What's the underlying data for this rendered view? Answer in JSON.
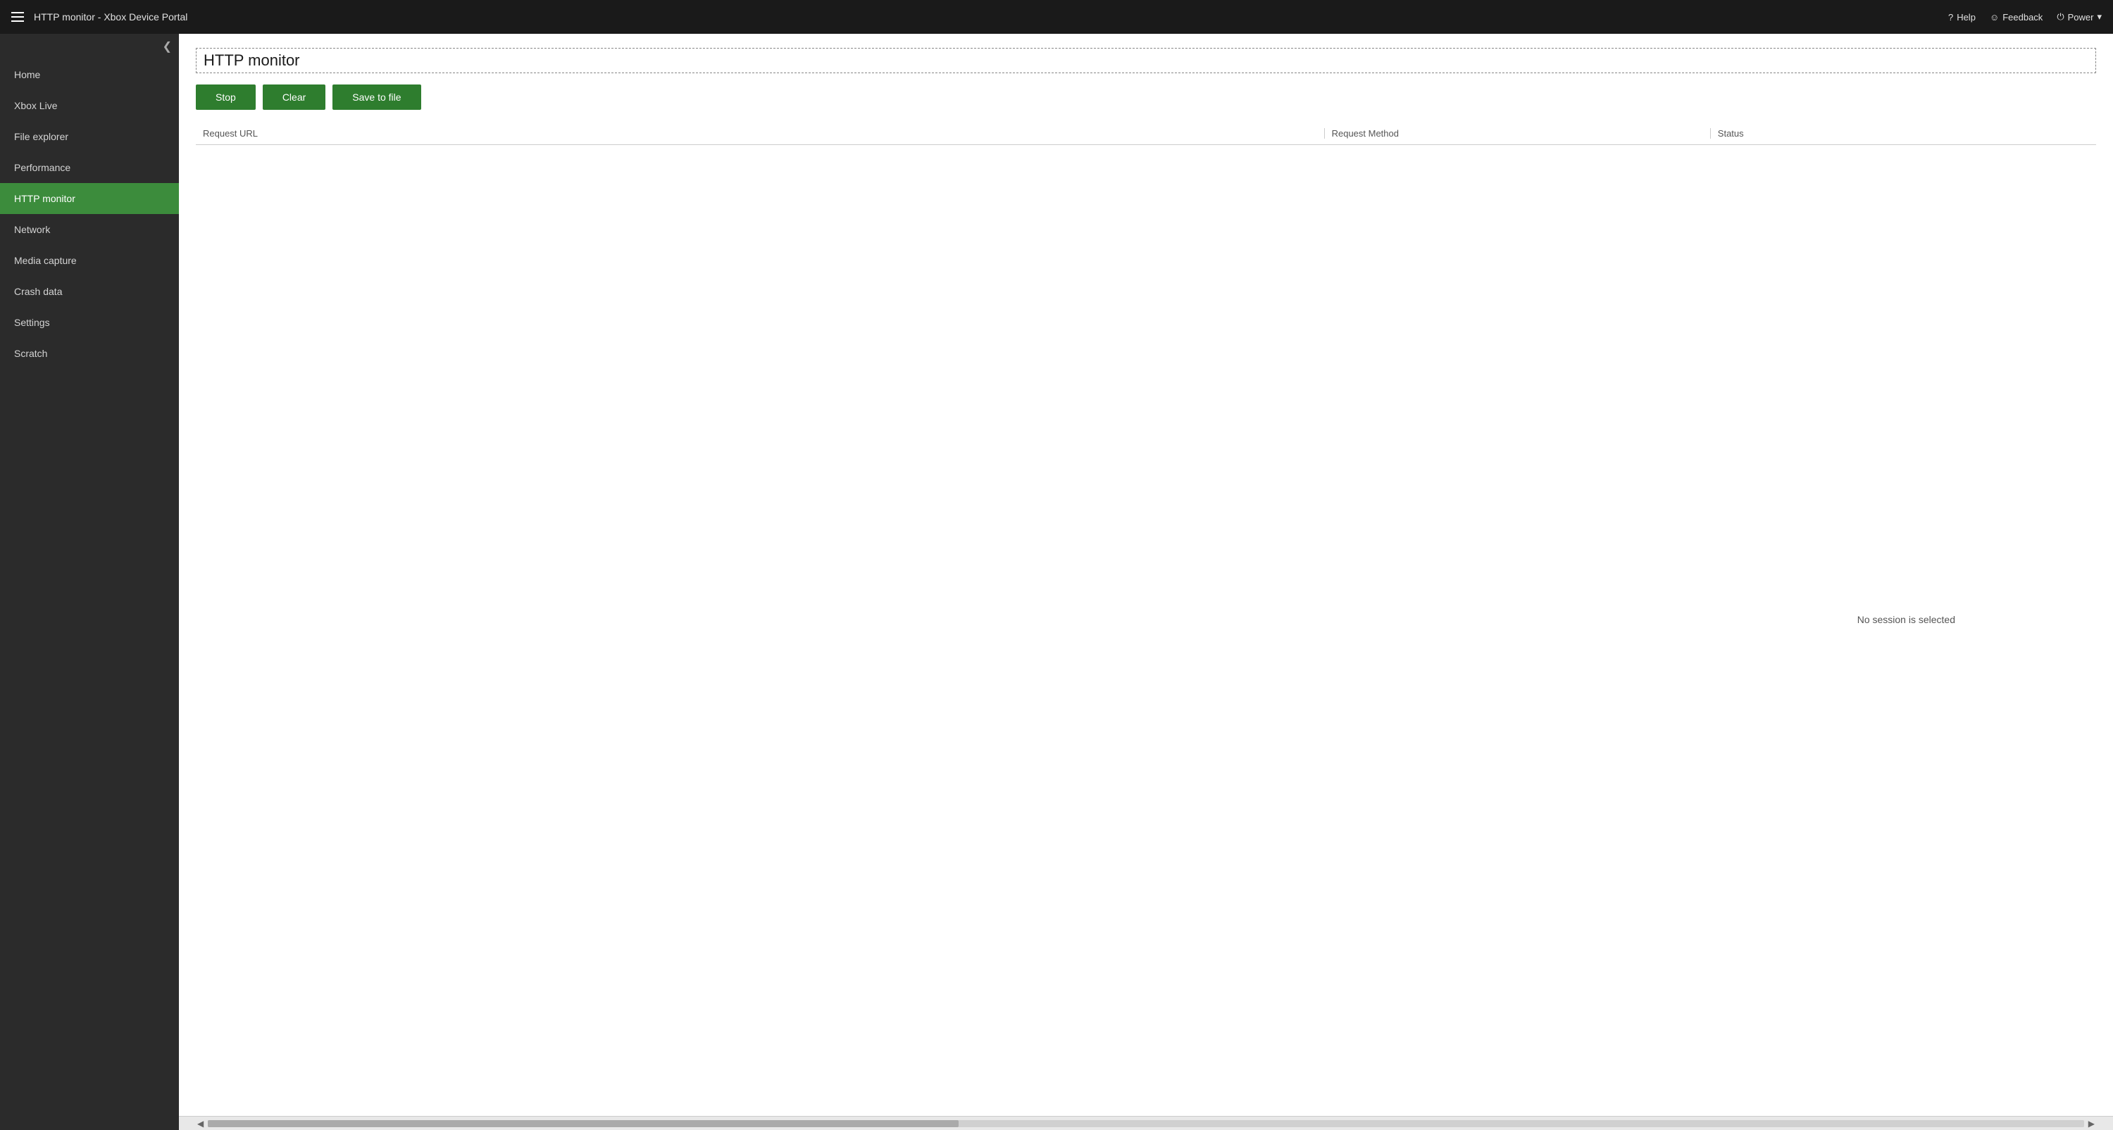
{
  "titlebar": {
    "title": "HTTP monitor - Xbox Device Portal",
    "help_label": "Help",
    "feedback_label": "Feedback",
    "power_label": "Power"
  },
  "sidebar": {
    "collapse_icon": "❮",
    "items": [
      {
        "id": "home",
        "label": "Home",
        "active": false
      },
      {
        "id": "xbox-live",
        "label": "Xbox Live",
        "active": false
      },
      {
        "id": "file-explorer",
        "label": "File explorer",
        "active": false
      },
      {
        "id": "performance",
        "label": "Performance",
        "active": false
      },
      {
        "id": "http-monitor",
        "label": "HTTP monitor",
        "active": true
      },
      {
        "id": "network",
        "label": "Network",
        "active": false
      },
      {
        "id": "media-capture",
        "label": "Media capture",
        "active": false
      },
      {
        "id": "crash-data",
        "label": "Crash data",
        "active": false
      },
      {
        "id": "settings",
        "label": "Settings",
        "active": false
      },
      {
        "id": "scratch",
        "label": "Scratch",
        "active": false
      }
    ]
  },
  "main": {
    "page_title": "HTTP monitor",
    "toolbar": {
      "stop_label": "Stop",
      "clear_label": "Clear",
      "save_label": "Save to file"
    },
    "table": {
      "col_url": "Request URL",
      "col_method": "Request Method",
      "col_status": "Status"
    },
    "no_session_text": "No session is selected"
  }
}
